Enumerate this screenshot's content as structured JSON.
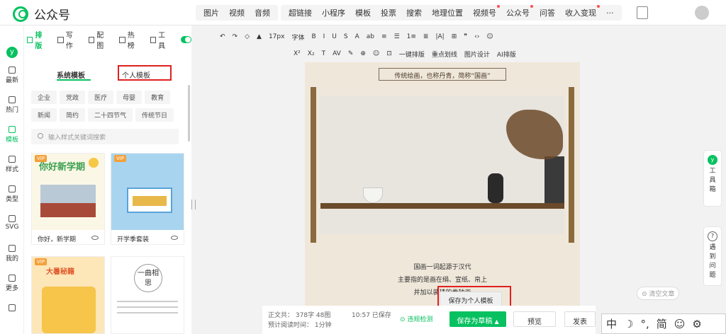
{
  "app": {
    "title": "公众号"
  },
  "top_menu": {
    "group1": [
      "图片",
      "视频",
      "音频"
    ],
    "group2": [
      {
        "label": "超链接",
        "dot": false
      },
      {
        "label": "小程序",
        "dot": false
      },
      {
        "label": "模板",
        "dot": false
      },
      {
        "label": "投票",
        "dot": false
      },
      {
        "label": "搜索",
        "dot": false
      },
      {
        "label": "地理位置",
        "dot": false
      },
      {
        "label": "视频号",
        "dot": true
      },
      {
        "label": "公众号",
        "dot": true
      },
      {
        "label": "问答",
        "dot": false
      },
      {
        "label": "收入变现",
        "dot": true
      },
      {
        "label": "···",
        "dot": false
      }
    ]
  },
  "left_nav": [
    "最新",
    "热门",
    "模板",
    "样式",
    "类型",
    "SVG",
    "我的",
    "更多",
    ""
  ],
  "panel": {
    "tabs": [
      "排版",
      "写作",
      "配图",
      "热榜",
      "工具"
    ],
    "subtabs": {
      "system": "系统模板",
      "personal": "个人模板"
    },
    "tags": [
      "企业",
      "党政",
      "医疗",
      "母婴",
      "教育",
      "新闻",
      "简约",
      "二十四节气",
      "传统节日"
    ],
    "search_placeholder": "输入样式关键词搜索",
    "cards": [
      {
        "name": "你好，新学期",
        "vip": "VIP",
        "headline": "你好新学期"
      },
      {
        "name": "开学季套装",
        "vip": "VIP",
        "headline": ""
      },
      {
        "name": "",
        "vip": "VIP",
        "headline": "大暑秘籍"
      },
      {
        "name": "",
        "vip": "",
        "headline": "一曲相思"
      }
    ]
  },
  "toolbar": {
    "row1": [
      "↶",
      "↷",
      "◇",
      "▲",
      "17px",
      "字体",
      "B",
      "I",
      "U",
      "S",
      "A",
      "ab",
      "≡",
      "☰",
      "1≡",
      "≣",
      "|A|",
      "⊞",
      "❞",
      "‹›",
      "☺"
    ],
    "row2": [
      "X²",
      "X₂",
      "T",
      "AV",
      "✎",
      "⊕",
      "☺",
      "⊡",
      "一键排版",
      "重点划线",
      "图片设计",
      "AI排版"
    ]
  },
  "editor": {
    "heading": "传统绘画，也称丹青，简称“国画”",
    "lines": [
      "国画一词起源于汉代",
      "主要指的是画在绢、宣纸、帛上",
      "并加以装裱的卷轴画"
    ]
  },
  "bottom": {
    "word_count_label": "正文共：",
    "word_count": "378字 48图",
    "read_time_label": "预计阅读时间：",
    "read_time": "1分钟",
    "saved": "10:57 已保存",
    "compliance": "违规检测",
    "save_draft": "保存为草稿",
    "preview": "预览",
    "publish": "发表",
    "tooltip": "保存为个人模板",
    "clear": "清空文章"
  },
  "right_widgets": {
    "tools": "工具箱",
    "help": "遇到问题"
  },
  "ime": [
    "中",
    "☽",
    "°,",
    "简",
    "☺",
    "⚙"
  ],
  "colors": {
    "brand": "#07c160",
    "highlight": "#e02020"
  }
}
